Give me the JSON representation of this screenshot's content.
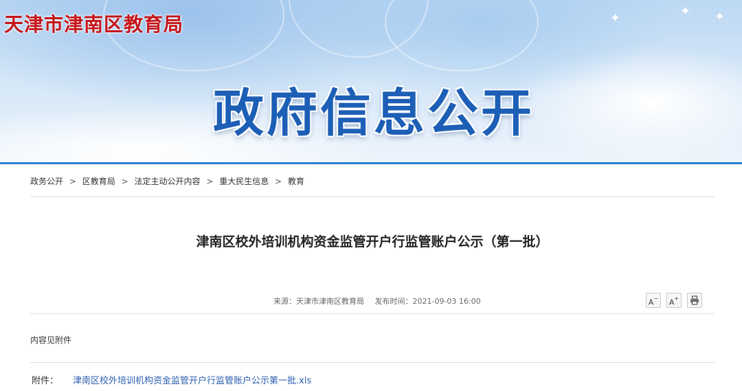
{
  "header": {
    "site_title": "天津市津南区教育局",
    "banner_heading": "政府信息公开"
  },
  "breadcrumb": {
    "items": [
      "政务公开",
      "区教育局",
      "法定主动公开内容",
      "重大民生信息",
      "教育"
    ],
    "separator": ">"
  },
  "article": {
    "title": "津南区校外培训机构资金监管开户行监管账户公示（第一批）",
    "source": "来源：天津市津南区教育局",
    "publish_time": "发布时间：2021-09-03 16:00",
    "body": "内容见附件",
    "attachment_label": "附件：",
    "attachment_name": "津南区校外培训机构资金监管开户行监管账户公示第一批.xls"
  },
  "tools": {
    "font_decrease": "A",
    "font_increase": "A",
    "decrease_mark": "−",
    "increase_mark": "+",
    "print_icon": "printer-icon"
  },
  "colors": {
    "site_title": "#c5151a",
    "banner_heading": "#1d5fb6",
    "accent_line": "#2b7fd1",
    "link": "#2a5db0"
  }
}
